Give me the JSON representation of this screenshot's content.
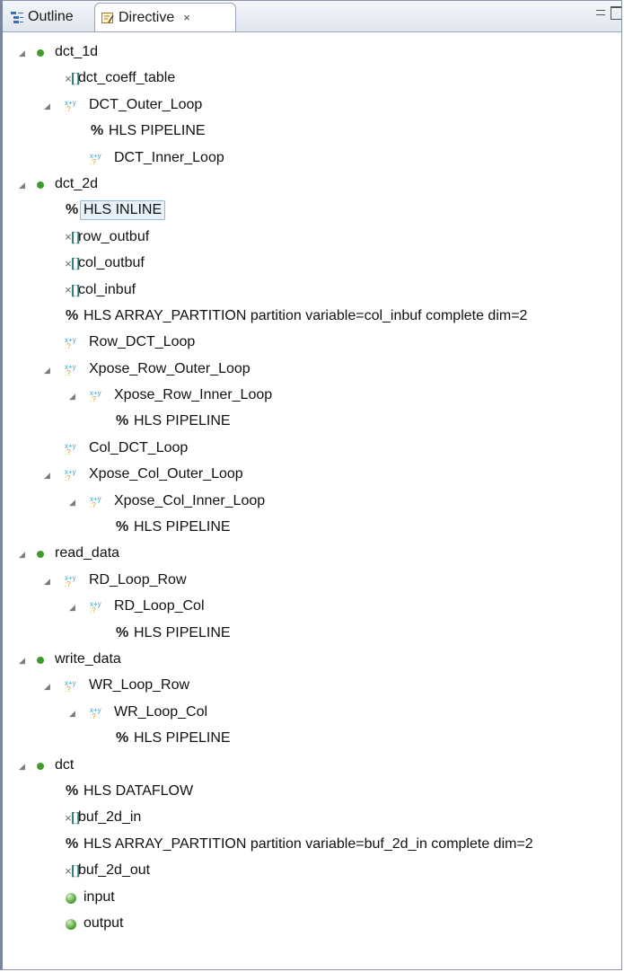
{
  "tabs": [
    {
      "label": "Outline"
    },
    {
      "label": "Directive",
      "close": "×"
    }
  ],
  "tree": [
    {
      "level": 0,
      "type": "func",
      "tw": true,
      "label": "dct_1d"
    },
    {
      "level": 1,
      "type": "array",
      "tw": false,
      "label": "dct_coeff_table"
    },
    {
      "level": 1,
      "type": "loop",
      "tw": true,
      "label": "DCT_Outer_Loop"
    },
    {
      "level": 2,
      "type": "pragma",
      "tw": false,
      "label": "HLS PIPELINE"
    },
    {
      "level": 2,
      "type": "loop",
      "tw": false,
      "label": "DCT_Inner_Loop"
    },
    {
      "level": 0,
      "type": "func",
      "tw": true,
      "label": "dct_2d"
    },
    {
      "level": 1,
      "type": "pragma",
      "tw": false,
      "label": "HLS INLINE",
      "selected": true
    },
    {
      "level": 1,
      "type": "array",
      "tw": false,
      "label": "row_outbuf"
    },
    {
      "level": 1,
      "type": "array",
      "tw": false,
      "label": "col_outbuf"
    },
    {
      "level": 1,
      "type": "array",
      "tw": false,
      "label": "col_inbuf"
    },
    {
      "level": 1,
      "type": "pragma",
      "tw": false,
      "label": "HLS ARRAY_PARTITION partition variable=col_inbuf complete dim=2"
    },
    {
      "level": 1,
      "type": "loop",
      "tw": false,
      "label": "Row_DCT_Loop"
    },
    {
      "level": 1,
      "type": "loop",
      "tw": true,
      "label": "Xpose_Row_Outer_Loop"
    },
    {
      "level": 2,
      "type": "loop",
      "tw": true,
      "label": "Xpose_Row_Inner_Loop"
    },
    {
      "level": 3,
      "type": "pragma",
      "tw": false,
      "label": "HLS PIPELINE"
    },
    {
      "level": 1,
      "type": "loop",
      "tw": false,
      "label": "Col_DCT_Loop"
    },
    {
      "level": 1,
      "type": "loop",
      "tw": true,
      "label": "Xpose_Col_Outer_Loop"
    },
    {
      "level": 2,
      "type": "loop",
      "tw": true,
      "label": "Xpose_Col_Inner_Loop"
    },
    {
      "level": 3,
      "type": "pragma",
      "tw": false,
      "label": "HLS PIPELINE"
    },
    {
      "level": 0,
      "type": "func",
      "tw": true,
      "label": "read_data"
    },
    {
      "level": 1,
      "type": "loop",
      "tw": true,
      "label": "RD_Loop_Row"
    },
    {
      "level": 2,
      "type": "loop",
      "tw": true,
      "label": "RD_Loop_Col"
    },
    {
      "level": 3,
      "type": "pragma",
      "tw": false,
      "label": "HLS PIPELINE"
    },
    {
      "level": 0,
      "type": "func",
      "tw": true,
      "label": "write_data"
    },
    {
      "level": 1,
      "type": "loop",
      "tw": true,
      "label": "WR_Loop_Row"
    },
    {
      "level": 2,
      "type": "loop",
      "tw": true,
      "label": "WR_Loop_Col"
    },
    {
      "level": 3,
      "type": "pragma",
      "tw": false,
      "label": "HLS PIPELINE"
    },
    {
      "level": 0,
      "type": "func",
      "tw": true,
      "label": "dct"
    },
    {
      "level": 1,
      "type": "pragma",
      "tw": false,
      "label": "HLS DATAFLOW"
    },
    {
      "level": 1,
      "type": "array",
      "tw": false,
      "label": "buf_2d_in"
    },
    {
      "level": 1,
      "type": "pragma",
      "tw": false,
      "label": "HLS ARRAY_PARTITION partition variable=buf_2d_in complete dim=2"
    },
    {
      "level": 1,
      "type": "array",
      "tw": false,
      "label": "buf_2d_out"
    },
    {
      "level": 1,
      "type": "port",
      "tw": false,
      "label": "input"
    },
    {
      "level": 1,
      "type": "port",
      "tw": false,
      "label": "output"
    }
  ]
}
